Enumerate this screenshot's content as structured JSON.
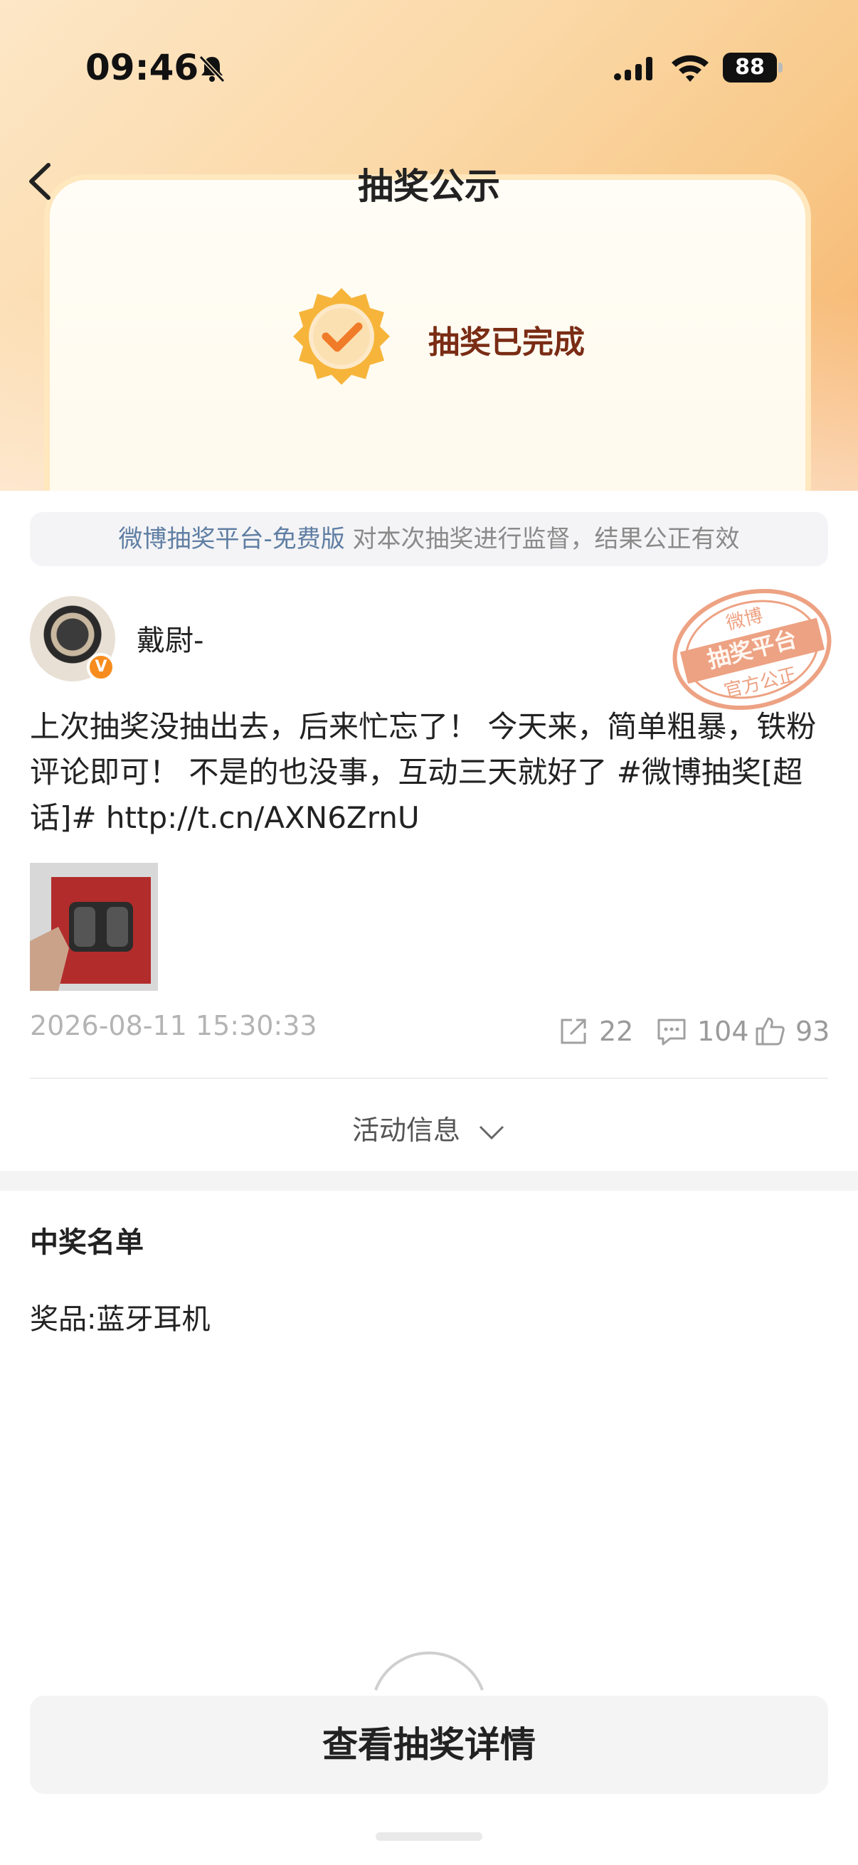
{
  "status_bar": {
    "time": "09:46",
    "battery": "88"
  },
  "nav": {
    "title": "抽奖公示"
  },
  "lottery": {
    "status": "抽奖已完成"
  },
  "notice": {
    "link": "微博抽奖平台-免费版",
    "text": " 对本次抽奖进行监督，结果公正有效"
  },
  "stamp": {
    "top": "微博",
    "middle": "抽奖平台",
    "bottom": "官方公正"
  },
  "post": {
    "author": "戴尉-",
    "verified_mark": "V",
    "text": "上次抽奖没抽出去，后来忙忘了！ 今天来，简单粗暴，铁粉评论即可！ 不是的也没事，互动三天就好了 #微博抽奖[超话]#  http://t.cn/AXN6ZrnU",
    "timestamp": "2026-08-11 15:30:33",
    "reposts": "22",
    "comments": "104",
    "likes": "93"
  },
  "activity_info": "活动信息",
  "winners": {
    "title": "中奖名单",
    "prize": "奖品:蓝牙耳机"
  },
  "cta": {
    "label": "查看抽奖详情"
  },
  "colors": {
    "accent_orange": "#f78c1e",
    "link_blue": "#5f7ea3",
    "status_brown": "#7a2c14"
  }
}
